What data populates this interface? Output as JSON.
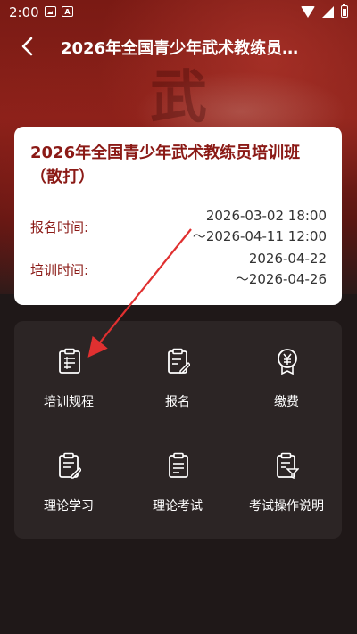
{
  "status_bar": {
    "time": "2:00"
  },
  "header": {
    "title": "2026年全国青少年武术教练员…"
  },
  "hero": {
    "glyph": "武"
  },
  "card": {
    "title": "2026年全国青少年武术教练员培训班（散打）",
    "registration": {
      "label": "报名时间:",
      "start": "2026-03-02 18:00",
      "end": "～2026-04-11 12:00"
    },
    "training": {
      "label": "培训时间:",
      "start": "2026-04-22",
      "end": "～2026-04-26"
    }
  },
  "menu": {
    "items": [
      {
        "label": "培训规程",
        "icon": "clipboard-list-icon"
      },
      {
        "label": "报名",
        "icon": "clipboard-edit-icon"
      },
      {
        "label": "缴费",
        "icon": "yuan-badge-icon"
      },
      {
        "label": "理论学习",
        "icon": "clipboard-pen-icon"
      },
      {
        "label": "理论考试",
        "icon": "clipboard-exam-icon"
      },
      {
        "label": "考试操作说明",
        "icon": "clipboard-filter-icon"
      }
    ]
  },
  "colors": {
    "accent": "#8b1a16",
    "background": "#1f1818",
    "panel": "#2c2525",
    "annotation_arrow": "#e03030"
  }
}
